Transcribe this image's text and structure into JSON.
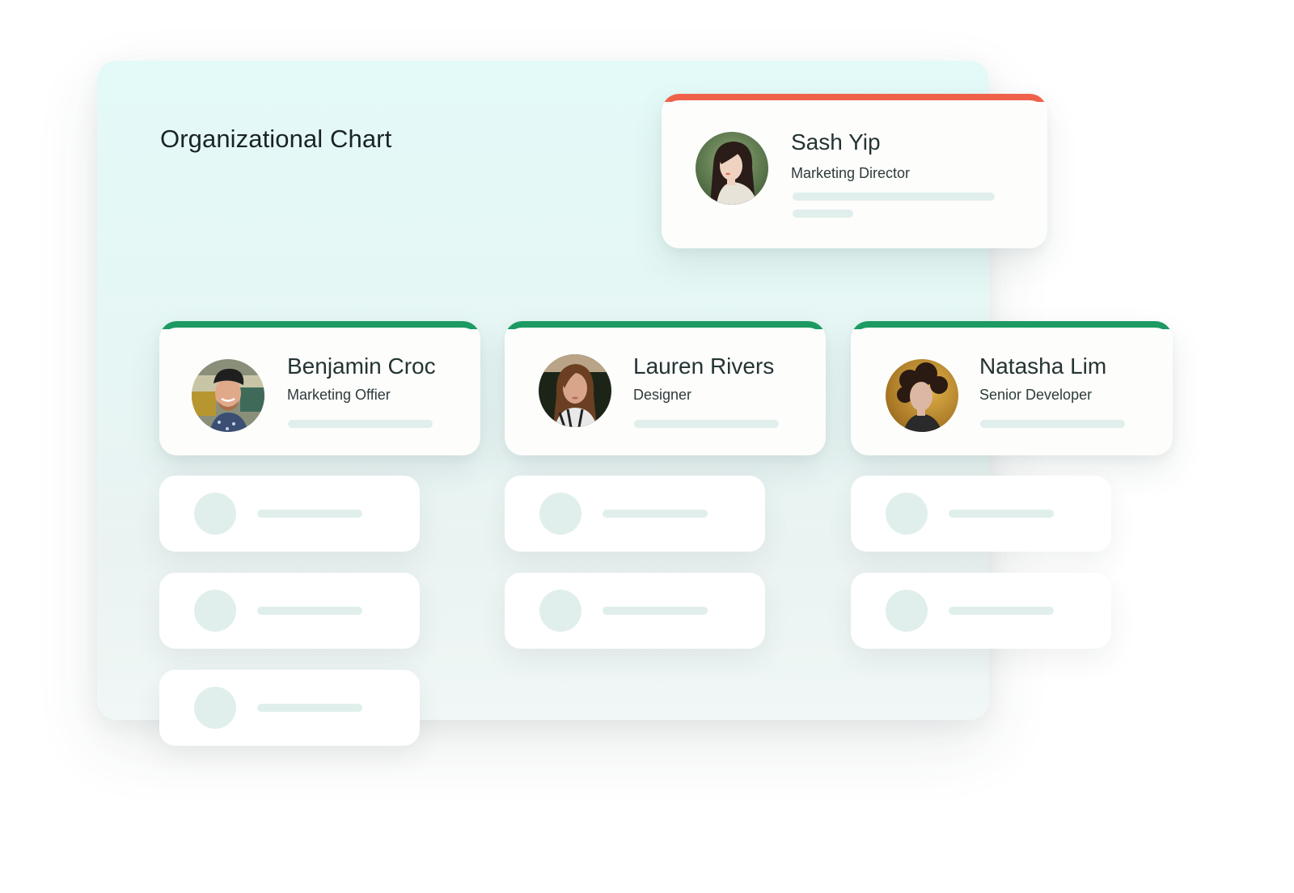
{
  "page": {
    "title": "Organizational Chart"
  },
  "colors": {
    "director_accent": "#f0614a",
    "team_accent": "#1c9a62",
    "skeleton": "#e0efeb",
    "panel_background": "#e3faf8"
  },
  "director": {
    "name": "Sash Yip",
    "role": "Marketing Director",
    "avatar": "photo-woman-long-dark-hair"
  },
  "team": [
    {
      "name": "Benjamin Croc",
      "role": "Marketing Offier",
      "avatar": "photo-man-backwards-cap"
    },
    {
      "name": "Lauren Rivers",
      "role": "Designer",
      "avatar": "photo-woman-long-brown-hair"
    },
    {
      "name": "Natasha Lim",
      "role": "Senior Developer",
      "avatar": "photo-woman-curly-hair"
    }
  ],
  "placeholder_counts": [
    3,
    2,
    2
  ]
}
